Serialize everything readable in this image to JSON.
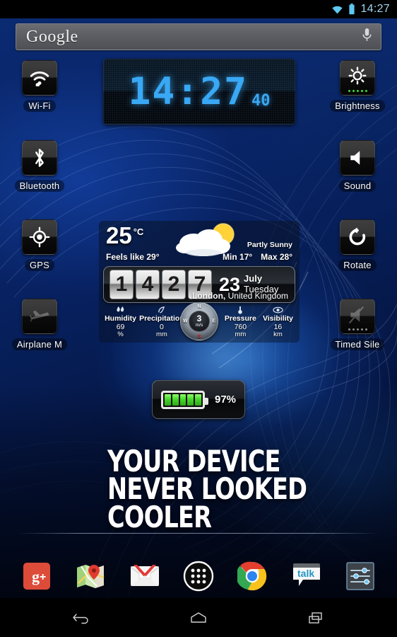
{
  "status_bar": {
    "time": "14:27",
    "wifi_icon": "wifi-icon",
    "battery_icon": "battery-icon"
  },
  "search": {
    "logo": "Google",
    "mic_icon": "microphone-icon",
    "placeholder": "Google"
  },
  "lcd_clock": {
    "hhmm": "14:27",
    "seconds": "40"
  },
  "toggles_left": [
    {
      "label": "Wi-Fi",
      "icon": "wifi-icon",
      "active": true
    },
    {
      "label": "Bluetooth",
      "icon": "bluetooth-icon",
      "active": true
    },
    {
      "label": "GPS",
      "icon": "gps-icon",
      "active": true
    },
    {
      "label": "Airplane M",
      "icon": "airplane-icon",
      "active": false
    }
  ],
  "toggles_right": [
    {
      "label": "Brightness",
      "icon": "brightness-icon",
      "active": true,
      "dots": 5,
      "dots_color": "#39e03a"
    },
    {
      "label": "Sound",
      "icon": "sound-icon",
      "active": true
    },
    {
      "label": "Rotate",
      "icon": "rotate-icon",
      "active": true
    },
    {
      "label": "Timed Sile",
      "icon": "mute-icon",
      "active": false,
      "dots": 5,
      "dots_color": "#8d8d8d"
    }
  ],
  "weather": {
    "temperature": "25",
    "unit": "°C",
    "feels_like": "Feels like  29°",
    "condition": "Partly Sunny",
    "min": "Min 17°",
    "max": "Max 28°",
    "cloud_icon": "partly-sunny-icon",
    "clock_digits": [
      "1",
      "4",
      "2",
      "7"
    ],
    "day_number": "23",
    "month": "July",
    "weekday": "Tuesday",
    "location_city": "London,",
    "location_country": " United Kingdom",
    "stats": [
      {
        "title": "Humidity",
        "value": "69",
        "unit": "%",
        "icon": "humidity-icon"
      },
      {
        "title": "Precipitation",
        "value": "0",
        "unit": "mm",
        "icon": "precipitation-icon"
      },
      {
        "title": "Pressure",
        "value": "760",
        "unit": "mm",
        "icon": "pressure-icon"
      },
      {
        "title": "Visibility",
        "value": "16",
        "unit": "km",
        "icon": "visibility-icon"
      }
    ],
    "compass": {
      "wind_speed": "3",
      "wind_unit": "m/s",
      "north": "N",
      "south": "S",
      "west": "W",
      "east": "E"
    }
  },
  "battery": {
    "percent": "97%",
    "bars": 5,
    "bar_color": "#47d62c"
  },
  "promo": {
    "line1": "YOUR DEVICE",
    "line2": "NEVER LOOKED",
    "line3": "COOLER"
  },
  "dock": [
    {
      "label": "Google+",
      "icon": "google-plus-icon"
    },
    {
      "label": "Maps",
      "icon": "maps-icon"
    },
    {
      "label": "Gmail",
      "icon": "gmail-icon"
    },
    {
      "label": "Apps",
      "icon": "app-drawer-icon"
    },
    {
      "label": "Chrome",
      "icon": "chrome-icon"
    },
    {
      "label": "Talk",
      "icon": "talk-icon"
    },
    {
      "label": "Settings",
      "icon": "equalizer-icon"
    }
  ],
  "nav_bar": [
    {
      "label": "Back",
      "icon": "back-icon"
    },
    {
      "label": "Home",
      "icon": "home-icon"
    },
    {
      "label": "Recents",
      "icon": "recents-icon"
    }
  ],
  "colors": {
    "accent": "#39a8f5",
    "wallpaper": "#0a2a72",
    "battery_green": "#47d62c"
  }
}
